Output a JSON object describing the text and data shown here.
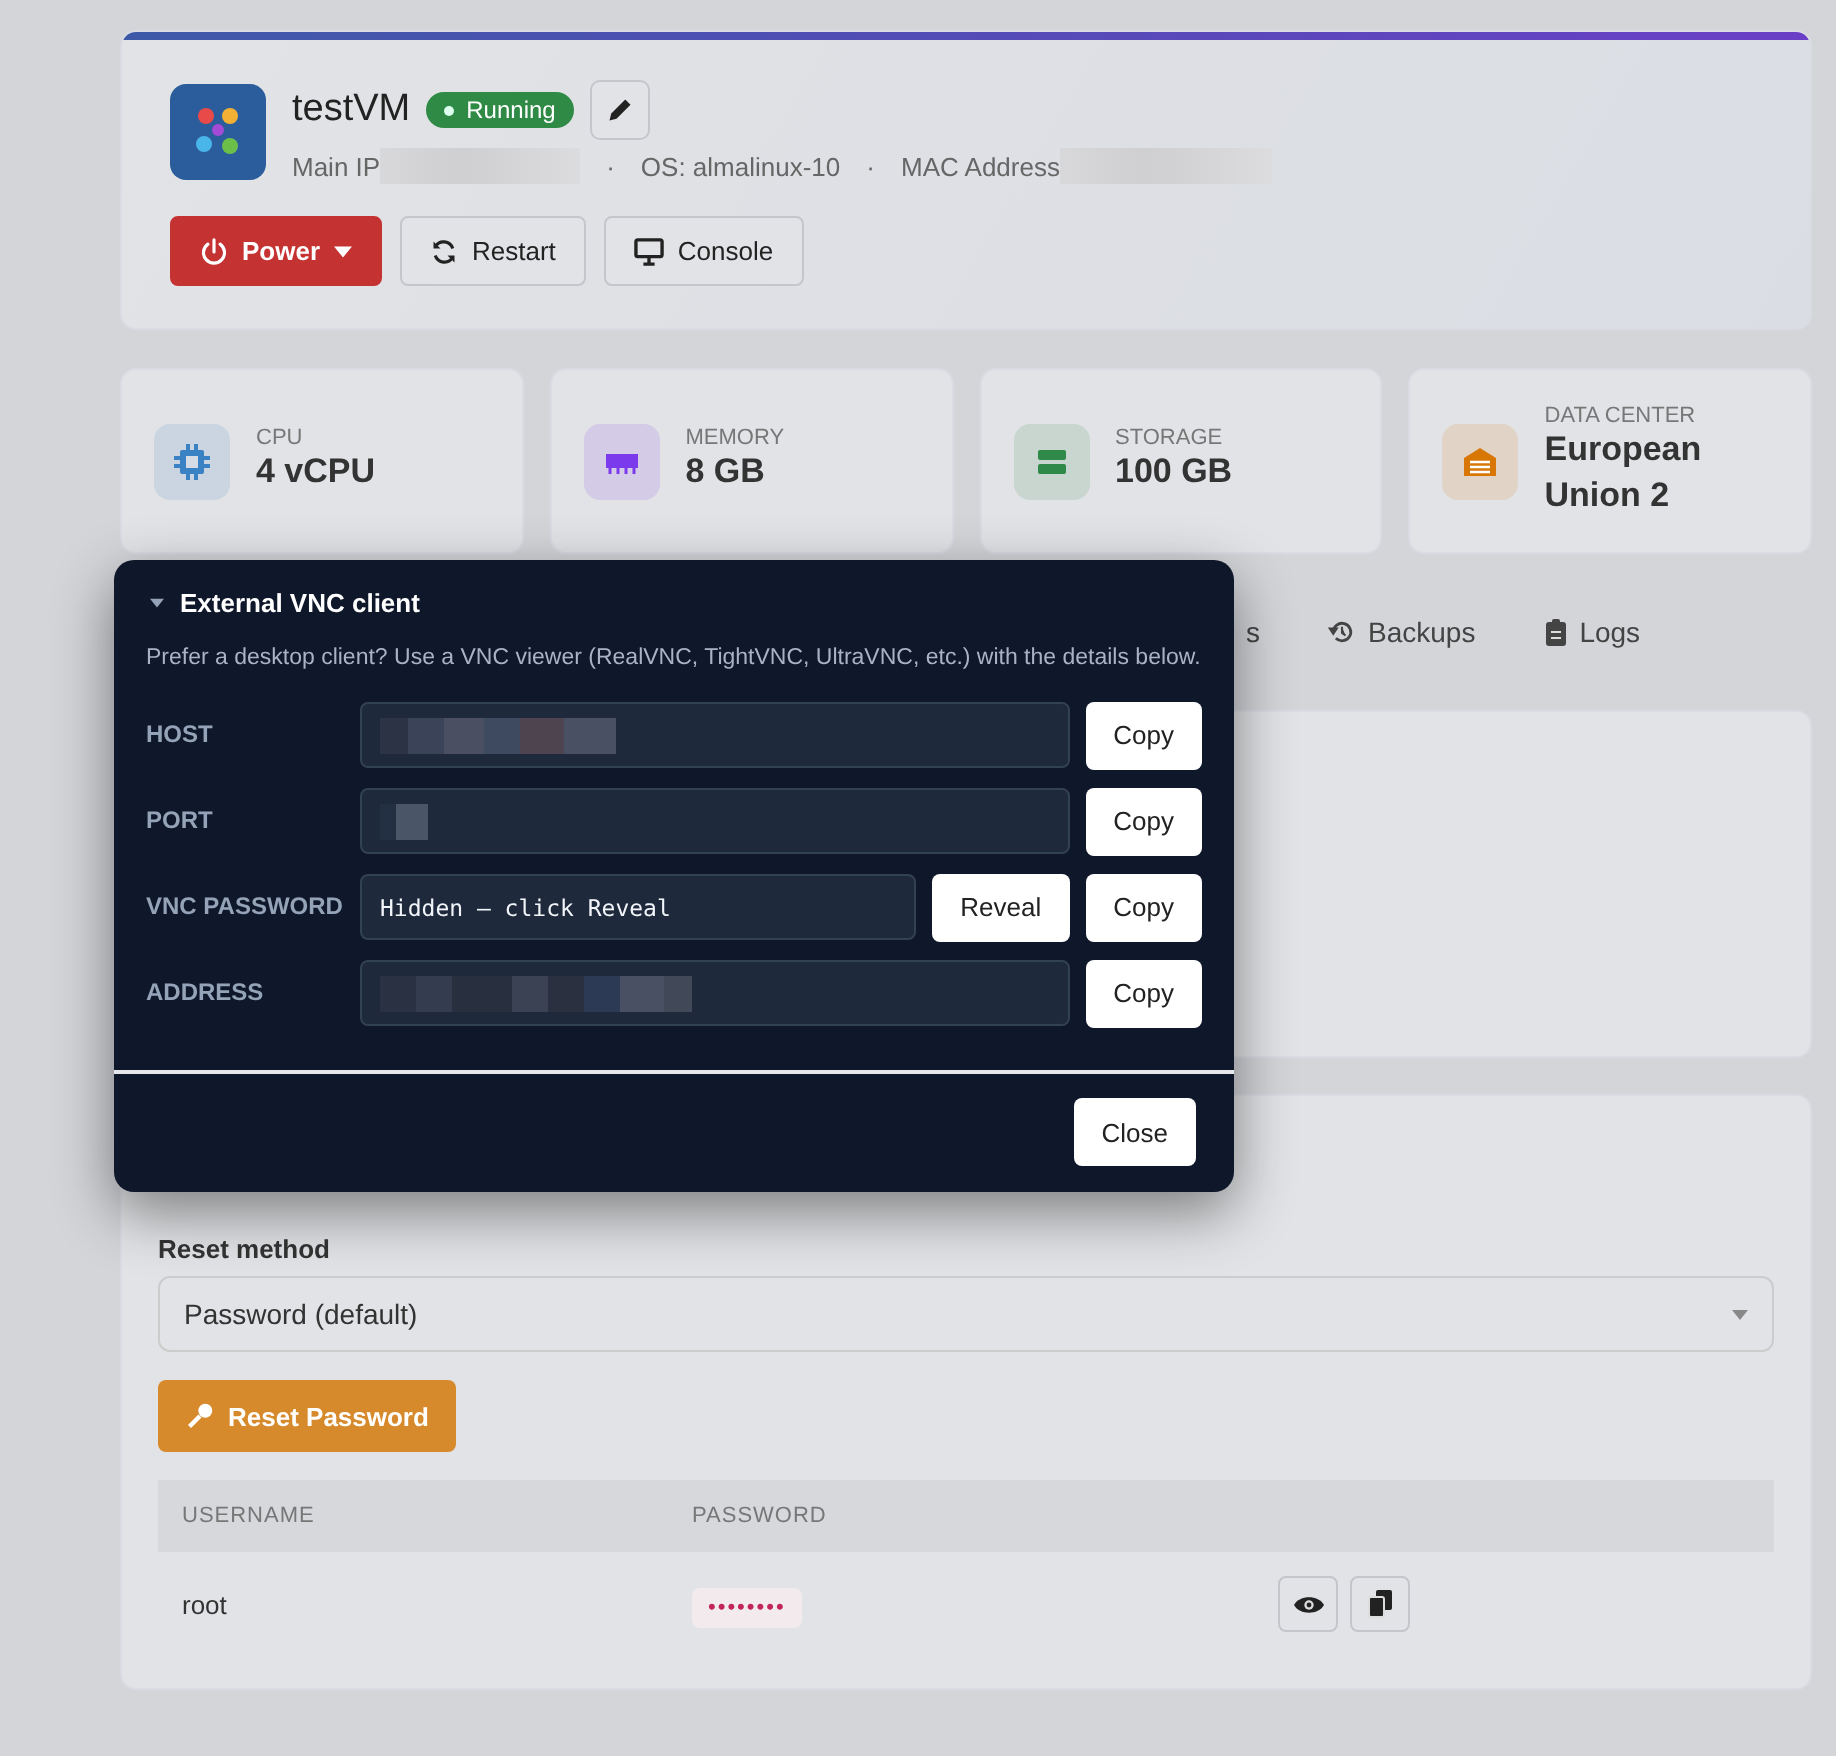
{
  "vm": {
    "name": "testVM",
    "status": "Running",
    "running": true,
    "main_ip_label": "Main IP",
    "os": "OS: almalinux-10",
    "mac_label": "MAC Address",
    "separators": [
      "·",
      "·"
    ]
  },
  "actions": [
    {
      "label": "Power",
      "kind": "power"
    },
    {
      "label": "Restart",
      "kind": "restart"
    },
    {
      "label": "Console",
      "kind": "console"
    }
  ],
  "stats": [
    {
      "label": "CPU",
      "value": "4 vCPU",
      "kind": "cpu",
      "color": "#3b82c4"
    },
    {
      "label": "MEMORY",
      "value": "8 GB",
      "kind": "memory",
      "color": "#7c3aed"
    },
    {
      "label": "STORAGE",
      "value": "100 GB",
      "kind": "storage",
      "color": "#2f8a4a"
    },
    {
      "label": "DATA CENTER",
      "value": "European Union 2",
      "kind": "datacenter",
      "color": "#d97706"
    }
  ],
  "tabs": [
    {
      "label": "s",
      "kind": "none"
    },
    {
      "label": "Backups",
      "kind": "backups"
    },
    {
      "label": "Logs",
      "kind": "logs"
    }
  ],
  "vnc_modal": {
    "title": "External VNC client",
    "expanded": true,
    "description": "Prefer a desktop client? Use a VNC viewer (RealVNC, TightVNC, UltraVNC, etc.) with the details below.",
    "fields": [
      {
        "label": "HOST",
        "buttons": [
          "Copy"
        ]
      },
      {
        "label": "PORT",
        "buttons": [
          "Copy"
        ]
      },
      {
        "label": "VNC PASSWORD",
        "value": "Hidden — click Reveal",
        "buttons": [
          "Reveal",
          "Copy"
        ]
      },
      {
        "label": "ADDRESS",
        "buttons": [
          "Copy"
        ]
      }
    ],
    "close": "Close"
  },
  "reset": {
    "label": "Reset method",
    "select_value": "Password (default)",
    "button": "Reset Password",
    "columns": [
      "USERNAME",
      "PASSWORD"
    ],
    "rows": [
      {
        "username": "root",
        "password": "••••••••"
      }
    ]
  }
}
